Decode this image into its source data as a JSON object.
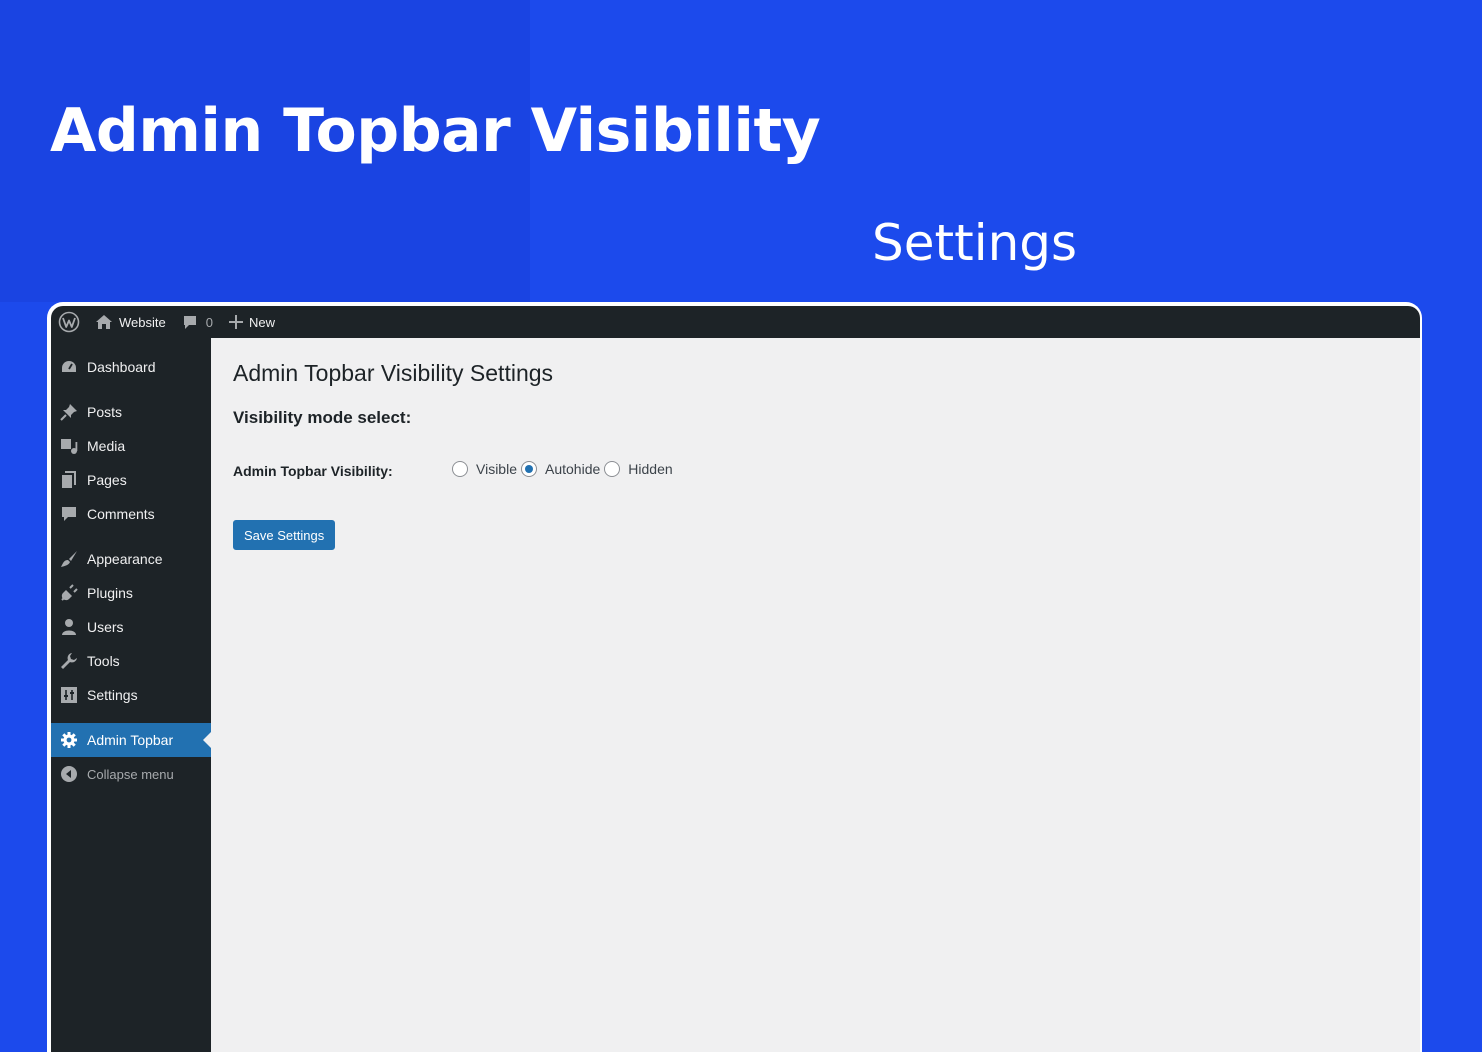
{
  "hero": {
    "title": "Admin Topbar Visibility",
    "subtitle": "Settings"
  },
  "admin_bar": {
    "site_name": "Website",
    "comments_count": "0",
    "new_label": "New"
  },
  "sidebar": {
    "items": [
      {
        "label": "Dashboard",
        "icon": "dashboard-icon"
      },
      {
        "label": "Posts",
        "icon": "pin-icon"
      },
      {
        "label": "Media",
        "icon": "media-icon"
      },
      {
        "label": "Pages",
        "icon": "pages-icon"
      },
      {
        "label": "Comments",
        "icon": "comment-icon"
      },
      {
        "label": "Appearance",
        "icon": "brush-icon"
      },
      {
        "label": "Plugins",
        "icon": "plug-icon"
      },
      {
        "label": "Users",
        "icon": "user-icon"
      },
      {
        "label": "Tools",
        "icon": "wrench-icon"
      },
      {
        "label": "Settings",
        "icon": "settings-sliders-icon"
      },
      {
        "label": "Admin Topbar",
        "icon": "gear-icon",
        "active": true
      }
    ],
    "collapse_label": "Collapse menu"
  },
  "main": {
    "page_title": "Admin Topbar Visibility Settings",
    "section_title": "Visibility mode select:",
    "field_label": "Admin Topbar Visibility:",
    "options": [
      {
        "label": "Visible",
        "checked": false
      },
      {
        "label": "Autohide",
        "checked": true
      },
      {
        "label": "Hidden",
        "checked": false
      }
    ],
    "save_label": "Save Settings"
  },
  "colors": {
    "background": "#1c4aec",
    "admin_dark": "#1d2327",
    "accent": "#2271b1",
    "content_bg": "#f0f0f1"
  }
}
